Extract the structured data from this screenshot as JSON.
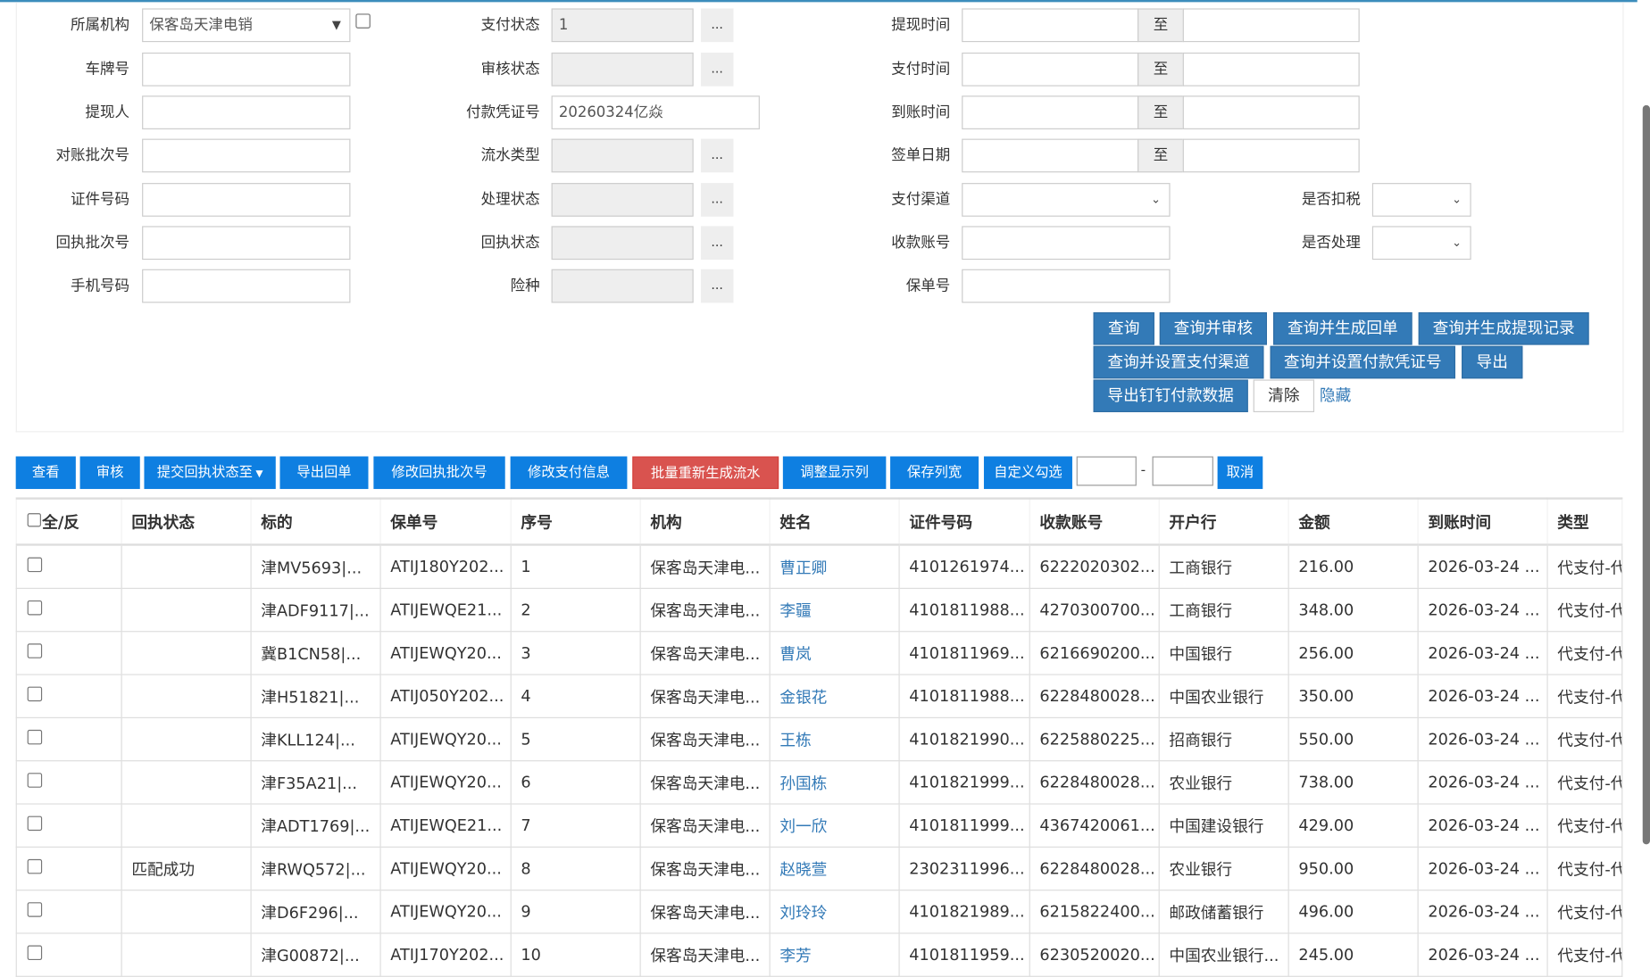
{
  "filters": {
    "org": {
      "label": "所属机构",
      "value": "保客岛天津电销"
    },
    "plate": {
      "label": "车牌号"
    },
    "withdrawer": {
      "label": "提现人"
    },
    "recon_batch": {
      "label": "对账批次号"
    },
    "id_no": {
      "label": "证件号码"
    },
    "receipt_batch": {
      "label": "回执批次号"
    },
    "phone": {
      "label": "手机号码"
    },
    "pay_status": {
      "label": "支付状态",
      "value": "1"
    },
    "audit_status": {
      "label": "审核状态"
    },
    "voucher_no": {
      "label": "付款凭证号",
      "value": "20260324亿焱"
    },
    "flow_type": {
      "label": "流水类型"
    },
    "process_status": {
      "label": "处理状态"
    },
    "receipt_status": {
      "label": "回执状态"
    },
    "insurance_type": {
      "label": "险种"
    },
    "withdraw_time": {
      "label": "提现时间"
    },
    "pay_time": {
      "label": "支付时间"
    },
    "arrive_time": {
      "label": "到账时间"
    },
    "sign_date": {
      "label": "签单日期"
    },
    "pay_channel": {
      "label": "支付渠道"
    },
    "account_no": {
      "label": "收款账号"
    },
    "policy_no": {
      "label": "保单号"
    },
    "tax": {
      "label": "是否扣税"
    },
    "handled": {
      "label": "是否处理"
    },
    "dots": "...",
    "to": "至"
  },
  "query_buttons": [
    "查询",
    "查询并审核",
    "查询并生成回单",
    "查询并生成提现记录",
    "查询并设置支付渠道",
    "查询并设置付款凭证号",
    "导出",
    "导出钉钉付款数据",
    "清除",
    "隐藏"
  ],
  "toolbar": {
    "view": "查看",
    "audit": "审核",
    "submit_receipt": "提交回执状态至",
    "export_receipt": "导出回单",
    "edit_receipt_batch": "修改回执批次号",
    "edit_pay_info": "修改支付信息",
    "regen_flow": "批量重新生成流水",
    "adjust_cols": "调整显示列",
    "save_width": "保存列宽",
    "custom_check": "自定义勾选",
    "dash": "-",
    "cancel": "取消"
  },
  "table": {
    "headers": [
      "全/反",
      "回执状态",
      "标的",
      "保单号",
      "序号",
      "机构",
      "姓名",
      "证件号码",
      "收款账号",
      "开户行",
      "金额",
      "到账时间",
      "类型"
    ],
    "rows": [
      [
        "",
        "津MV5693|...",
        "ATIJ180Y202...",
        "1",
        "保客岛天津电...",
        "曹正卿",
        "4101261974...",
        "6222020302...",
        "工商银行",
        "216.00",
        "2026-03-24 ...",
        "代支付-代"
      ],
      [
        "",
        "津ADF9117|...",
        "ATIJEWQE21...",
        "2",
        "保客岛天津电...",
        "李疆",
        "4101811988...",
        "4270300700...",
        "工商银行",
        "348.00",
        "2026-03-24 ...",
        "代支付-代"
      ],
      [
        "",
        "冀B1CN58|...",
        "ATIJEWQY20...",
        "3",
        "保客岛天津电...",
        "曹岚",
        "4101811969...",
        "6216690200...",
        "中国银行",
        "256.00",
        "2026-03-24 ...",
        "代支付-代"
      ],
      [
        "",
        "津H51821|...",
        "ATIJ050Y202...",
        "4",
        "保客岛天津电...",
        "金银花",
        "4101811988...",
        "6228480028...",
        "中国农业银行",
        "350.00",
        "2026-03-24 ...",
        "代支付-代"
      ],
      [
        "",
        "津KLL124|...",
        "ATIJEWQY20...",
        "5",
        "保客岛天津电...",
        "王栋",
        "4101821990...",
        "6225880225...",
        "招商银行",
        "550.00",
        "2026-03-24 ...",
        "代支付-代"
      ],
      [
        "",
        "津F35A21|...",
        "ATIJEWQY20...",
        "6",
        "保客岛天津电...",
        "孙国栋",
        "4101821999...",
        "6228480028...",
        "农业银行",
        "738.00",
        "2026-03-24 ...",
        "代支付-代"
      ],
      [
        "",
        "津ADT1769|...",
        "ATIJEWQE21...",
        "7",
        "保客岛天津电...",
        "刘一欣",
        "4101811999...",
        "4367420061...",
        "中国建设银行",
        "429.00",
        "2026-03-24 ...",
        "代支付-代"
      ],
      [
        "匹配成功",
        "津RWQ572|...",
        "ATIJEWQY20...",
        "8",
        "保客岛天津电...",
        "赵晓萱",
        "2302311996...",
        "6228480028...",
        "农业银行",
        "950.00",
        "2026-03-24 ...",
        "代支付-代"
      ],
      [
        "",
        "津D6F296|...",
        "ATIJEWQY20...",
        "9",
        "保客岛天津电...",
        "刘玲玲",
        "4101821989...",
        "6215822400...",
        "邮政储蓄银行",
        "496.00",
        "2026-03-24 ...",
        "代支付-代"
      ],
      [
        "",
        "津G00872|...",
        "ATIJ170Y202...",
        "10",
        "保客岛天津电...",
        "李芳",
        "4101811959...",
        "6230520020...",
        "中国农业银行...",
        "245.00",
        "2026-03-24 ...",
        "代支付-代"
      ]
    ]
  }
}
